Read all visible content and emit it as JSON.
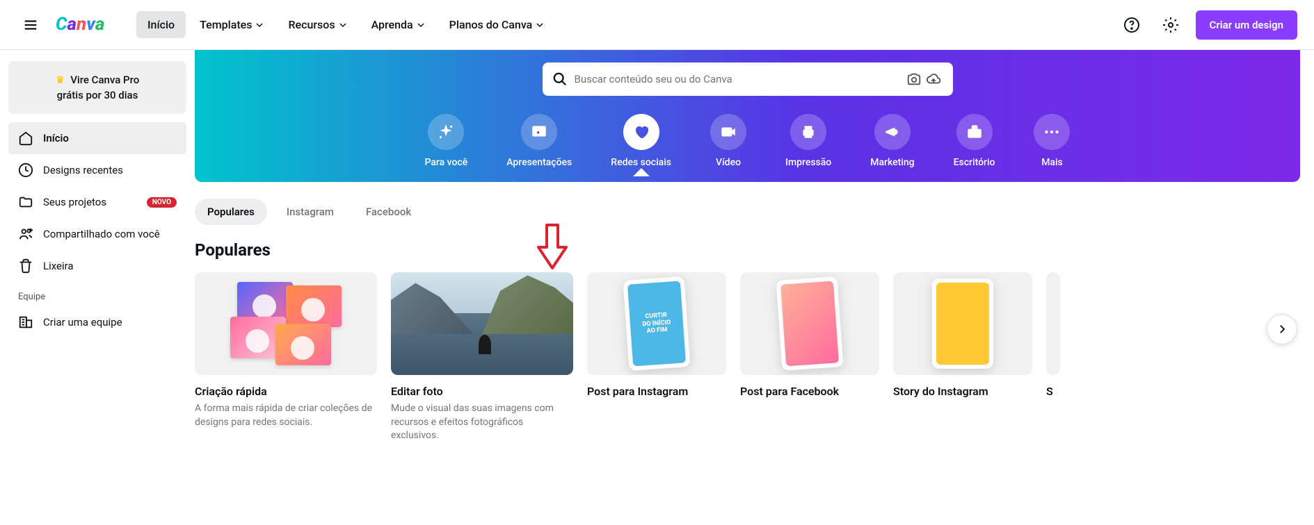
{
  "topnav": {
    "home": "Início",
    "templates": "Templates",
    "resources": "Recursos",
    "learn": "Aprenda",
    "plans": "Planos do Canva",
    "create_design": "Criar um design"
  },
  "sidebar": {
    "pro_line1": "Vire Canva Pro",
    "pro_line2": "grátis por 30 dias",
    "items": {
      "home": "Início",
      "recent": "Designs recentes",
      "projects": "Seus projetos",
      "projects_badge": "NOVO",
      "shared": "Compartilhado com você",
      "trash": "Lixeira"
    },
    "team_heading": "Equipe",
    "create_team": "Criar uma equipe"
  },
  "search": {
    "placeholder": "Buscar conteúdo seu ou do Canva"
  },
  "categories": {
    "for_you": "Para você",
    "presentations": "Apresentações",
    "social": "Redes sociais",
    "video": "Vídeo",
    "print": "Impressão",
    "marketing": "Marketing",
    "office": "Escritório",
    "more": "Mais"
  },
  "tabs": {
    "popular": "Populares",
    "instagram": "Instagram",
    "facebook": "Facebook"
  },
  "section": {
    "title": "Populares"
  },
  "cards": {
    "quick": {
      "title": "Criação rápida",
      "desc": "A forma mais rápida de criar coleções de designs para redes sociais."
    },
    "edit": {
      "title": "Editar foto",
      "desc": "Mude o visual das suas imagens com recursos e efeitos fotográficos exclusivos."
    },
    "ig_post": {
      "title": "Post para Instagram"
    },
    "fb_post": {
      "title": "Post para Facebook"
    },
    "ig_story": {
      "title": "Story do Instagram"
    },
    "partial": {
      "title": "S"
    }
  },
  "phone_text": {
    "ig": "CURTIR\nDO INÍCIO\nAO FIM"
  }
}
